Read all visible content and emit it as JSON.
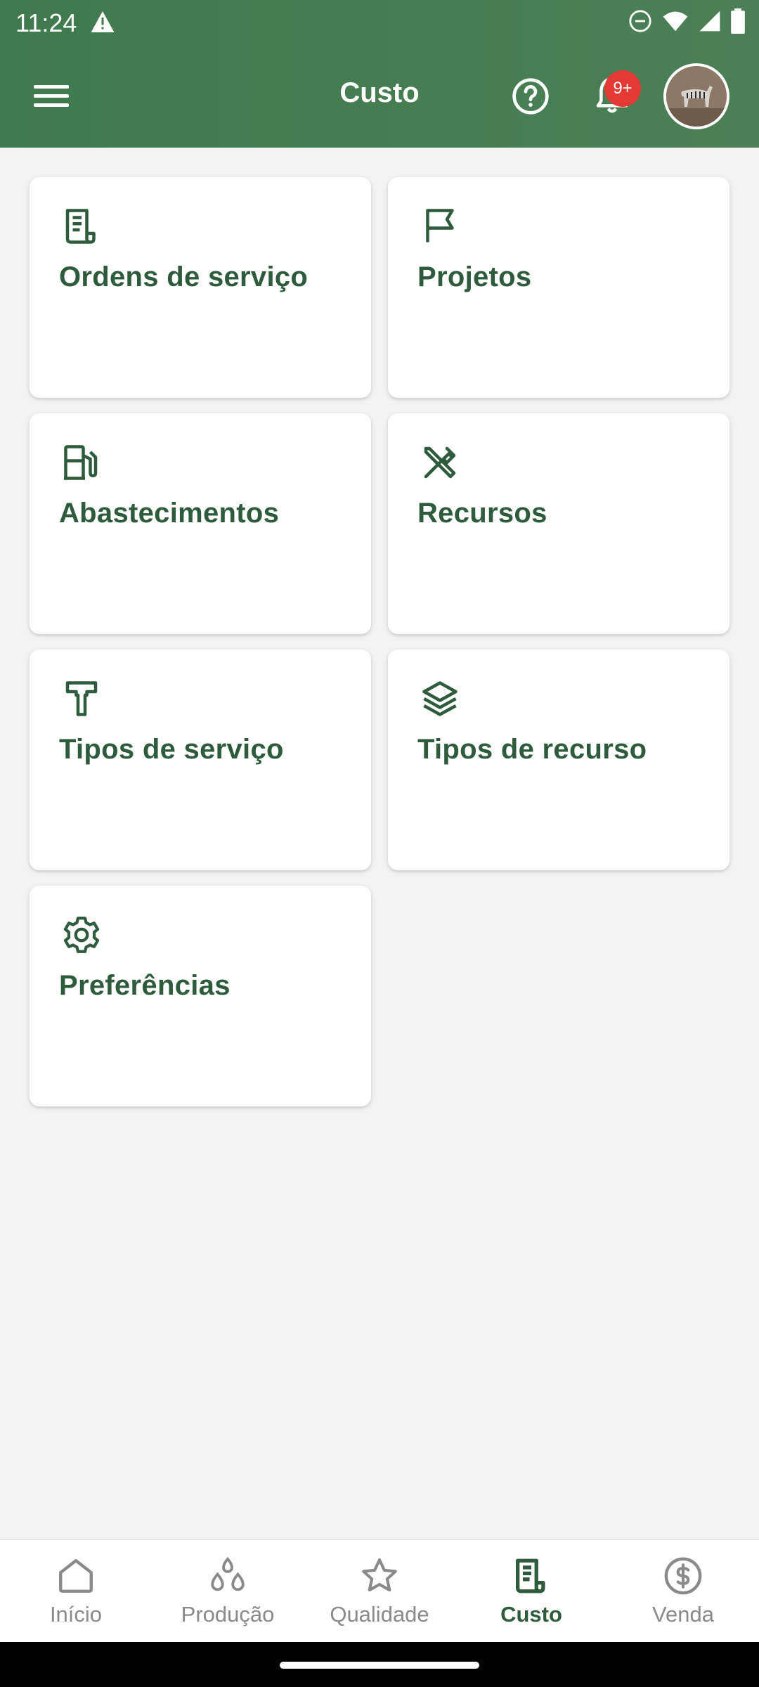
{
  "status_bar": {
    "time": "11:24"
  },
  "appbar": {
    "title": "Custo",
    "notification_badge": "9+"
  },
  "cards": [
    {
      "label": "Ordens de serviço",
      "icon": "document-icon"
    },
    {
      "label": "Projetos",
      "icon": "flag-icon"
    },
    {
      "label": "Abastecimentos",
      "icon": "fuel-pump-icon"
    },
    {
      "label": "Recursos",
      "icon": "tools-icon"
    },
    {
      "label": "Tipos de serviço",
      "icon": "hammer-icon"
    },
    {
      "label": "Tipos de recurso",
      "icon": "layers-icon"
    },
    {
      "label": "Preferências",
      "icon": "gear-icon"
    }
  ],
  "bottom_nav": [
    {
      "label": "Início",
      "icon": "home-icon",
      "active": false
    },
    {
      "label": "Produção",
      "icon": "drops-icon",
      "active": false
    },
    {
      "label": "Qualidade",
      "icon": "star-icon",
      "active": false
    },
    {
      "label": "Custo",
      "icon": "document-icon",
      "active": true
    },
    {
      "label": "Venda",
      "icon": "dollar-circle-icon",
      "active": false
    }
  ],
  "colors": {
    "appbar": "#44794f",
    "accent": "#2f5b3d",
    "badge": "#e53935"
  }
}
